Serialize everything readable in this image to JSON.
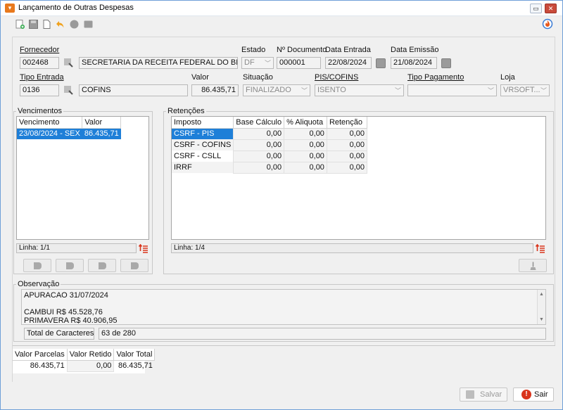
{
  "window": {
    "title": "Lançamento de Outras Despesas",
    "min_label": "▭",
    "close_label": "✕"
  },
  "fields": {
    "fornecedor_label": "Fornecedor",
    "fornecedor_code": "002468",
    "fornecedor_name": "SECRETARIA DA RECEITA FEDERAL DO BRASIL",
    "estado_label": "Estado",
    "estado_value": "DF",
    "documento_label": "Nº Documento",
    "documento_value": "000001",
    "data_entrada_label": "Data Entrada",
    "data_entrada_value": "22/08/2024",
    "data_emissao_label": "Data Emissão",
    "data_emissao_value": "21/08/2024",
    "tipo_entrada_label": "Tipo Entrada",
    "tipo_entrada_code": "0136",
    "tipo_entrada_name": "COFINS",
    "valor_label": "Valor",
    "valor_value": "86.435,71",
    "situacao_label": "Situação",
    "situacao_value": "FINALIZADO",
    "pis_cofins_label": "PIS/COFINS",
    "pis_cofins_value": "ISENTO",
    "tipo_pagamento_label": "Tipo Pagamento",
    "tipo_pagamento_value": "",
    "loja_label": "Loja",
    "loja_value": "VRSOFT..."
  },
  "vencimentos": {
    "title": "Vencimentos",
    "headers": [
      "Vencimento",
      "Valor"
    ],
    "rows": [
      {
        "vencimento": "23/08/2024 - SEX",
        "valor": "86.435,71"
      }
    ],
    "status": "Linha: 1/1"
  },
  "retencoes": {
    "title": "Retenções",
    "headers": [
      "Imposto",
      "Base Cálculo",
      "% Aliquota",
      "Retenção"
    ],
    "rows": [
      {
        "imposto": "CSRF - PIS",
        "base": "0,00",
        "aliquota": "0,00",
        "retencao": "0,00"
      },
      {
        "imposto": "CSRF - COFINS",
        "base": "0,00",
        "aliquota": "0,00",
        "retencao": "0,00"
      },
      {
        "imposto": "CSRF - CSLL",
        "base": "0,00",
        "aliquota": "0,00",
        "retencao": "0,00"
      },
      {
        "imposto": "IRRF",
        "base": "0,00",
        "aliquota": "0,00",
        "retencao": "0,00"
      }
    ],
    "status": "Linha: 1/4"
  },
  "observacao": {
    "title": "Observação",
    "lines": [
      "APURACAO 31/07/2024",
      "",
      "CAMBUI R$ 45.528,76",
      "PRIMAVERA R$ 40.906,95"
    ],
    "char_label": "Total de Caracteres:",
    "char_value": "63 de 280"
  },
  "totais": {
    "headers": [
      "Valor Parcelas",
      "Valor Retido",
      "Valor Total"
    ],
    "values": [
      "86.435,71",
      "0,00",
      "86.435,71"
    ]
  },
  "actions": {
    "salvar": "Salvar",
    "sair": "Sair"
  },
  "colors": {
    "accent": "#1e7fd8",
    "exit_red": "#d9341b",
    "icon_orange": "#e8791d"
  }
}
